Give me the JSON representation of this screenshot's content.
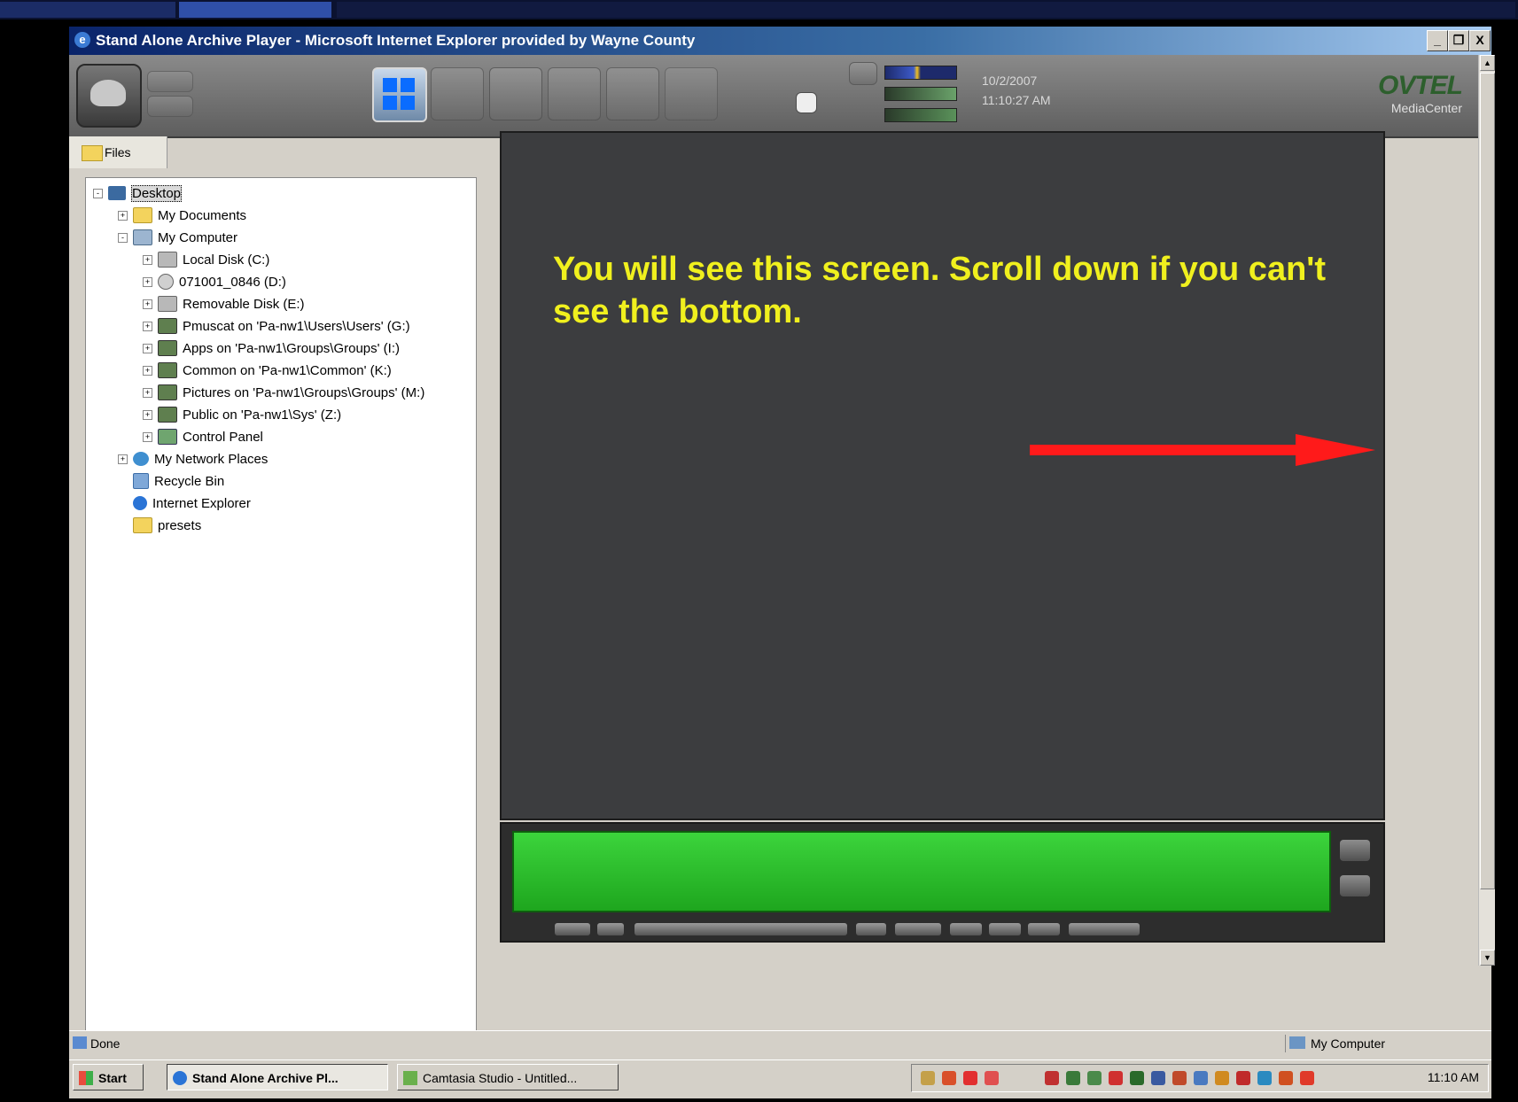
{
  "window": {
    "title": "Stand Alone Archive Player - Microsoft Internet Explorer provided by Wayne County",
    "buttons": {
      "minimize": "_",
      "restore": "❐",
      "close": "X"
    }
  },
  "toolbar": {
    "date": "10/2/2007",
    "time": "11:10:27 AM",
    "brand": "OVTEL",
    "brand_sub": "MediaCenter"
  },
  "left_panel": {
    "tab_label": "Files",
    "tree": [
      {
        "label": "Desktop",
        "icon": "desktop-icon",
        "toggle": "-"
      },
      {
        "label": "My Documents",
        "icon": "folder-icon",
        "toggle": "+"
      },
      {
        "label": "My Computer",
        "icon": "computer-icon",
        "toggle": "-"
      },
      {
        "label": "Local Disk (C:)",
        "icon": "disk-icon",
        "toggle": "+"
      },
      {
        "label": "071001_0846 (D:)",
        "icon": "cd-icon",
        "toggle": "+"
      },
      {
        "label": "Removable Disk (E:)",
        "icon": "disk-icon",
        "toggle": "+"
      },
      {
        "label": "Pmuscat on 'Pa-nw1\\Users\\Users' (G:)",
        "icon": "network-drive-icon",
        "toggle": "+"
      },
      {
        "label": "Apps on 'Pa-nw1\\Groups\\Groups' (I:)",
        "icon": "network-drive-icon",
        "toggle": "+"
      },
      {
        "label": "Common on 'Pa-nw1\\Common' (K:)",
        "icon": "network-drive-icon",
        "toggle": "+"
      },
      {
        "label": "Pictures on 'Pa-nw1\\Groups\\Groups' (M:)",
        "icon": "network-drive-icon",
        "toggle": "+"
      },
      {
        "label": "Public on 'Pa-nw1\\Sys' (Z:)",
        "icon": "network-drive-icon",
        "toggle": "+"
      },
      {
        "label": "Control Panel",
        "icon": "control-panel-icon",
        "toggle": "+"
      },
      {
        "label": "My Network Places",
        "icon": "network-places-icon",
        "toggle": "+"
      },
      {
        "label": "Recycle Bin",
        "icon": "recycle-bin-icon",
        "toggle": ""
      },
      {
        "label": "Internet Explorer",
        "icon": "ie-icon",
        "toggle": ""
      },
      {
        "label": "presets",
        "icon": "folder-icon",
        "toggle": ""
      }
    ]
  },
  "video": {
    "overlay_text": "You will see this screen. Scroll down if you can't see the bottom.",
    "overlay_color": "#f0f01e",
    "arrow_color": "#ff1a1a"
  },
  "timeline": {
    "bar_color": "#2cc22c"
  },
  "statusbar": {
    "status": "Done",
    "zone": "My Computer"
  },
  "taskbar": {
    "start": "Start",
    "tasks": [
      "Stand Alone Archive Pl...",
      "Camtasia Studio - Untitled..."
    ],
    "clock": "11:10 AM"
  }
}
